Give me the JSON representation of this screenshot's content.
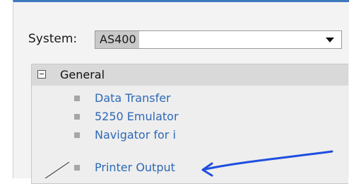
{
  "system": {
    "label": "System:",
    "selected": "AS400"
  },
  "tree": {
    "group_label": "General",
    "items": [
      {
        "label": "Data Transfer"
      },
      {
        "label": "5250 Emulator"
      },
      {
        "label": "Navigator for i"
      },
      {
        "label": "Printer Output"
      }
    ]
  },
  "colors": {
    "header_bar": "#3d79bd",
    "link_text": "#2e69b6",
    "annotation_ink": "#1f4fe0"
  },
  "icons": [
    "collapse-toggle-icon",
    "dropdown-arrow-icon",
    "item-bullet-icon"
  ]
}
